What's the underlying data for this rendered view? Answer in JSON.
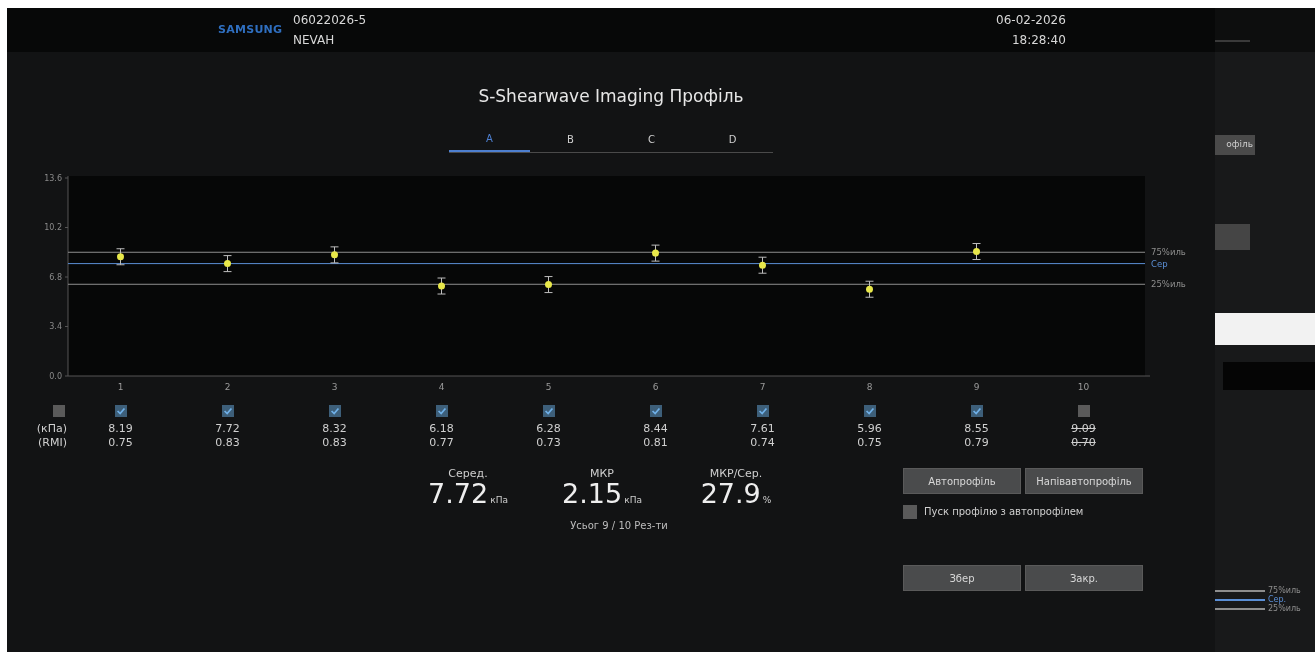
{
  "header": {
    "logo": "SAMSUNG",
    "patient_id": "06022026-5",
    "patient_name": "NEVAH",
    "date": "06-02-2026",
    "time": "18:28:40"
  },
  "title": "S-Shearwave Imaging Профіль",
  "tabs": [
    {
      "label": "A",
      "selected": true
    },
    {
      "label": "B",
      "selected": false
    },
    {
      "label": "C",
      "selected": false
    },
    {
      "label": "D",
      "selected": false
    }
  ],
  "chart_data": {
    "type": "scatter",
    "categories": [
      "1",
      "2",
      "3",
      "4",
      "5",
      "6",
      "7",
      "8",
      "9",
      "10"
    ],
    "series": [
      {
        "color": "#e8e84a",
        "values": [
          8.19,
          7.72,
          8.32,
          6.18,
          6.28,
          8.44,
          7.61,
          5.96,
          8.55,
          null
        ]
      }
    ],
    "ylim": [
      0,
      13.6
    ],
    "yticks": [
      {
        "value": 0,
        "label": "0.0"
      },
      {
        "value": 3.4,
        "label": "3.4"
      },
      {
        "value": 6.8,
        "label": "6.8"
      },
      {
        "value": 10.2,
        "label": "10.2"
      },
      {
        "value": 13.6,
        "label": "13.6"
      }
    ],
    "ref_lines": [
      {
        "axis": "y",
        "value": 8.5,
        "label": "75%иль",
        "color": "#8e8e8e"
      },
      {
        "axis": "y",
        "value": 7.72,
        "label": "Сер",
        "color": "#5b8fd6"
      },
      {
        "axis": "y",
        "value": 6.3,
        "label": "25%иль",
        "color": "#8e8e8e"
      }
    ]
  },
  "measurements": {
    "select_all": {
      "checked": false
    },
    "row_labels": [
      "(кПа)",
      "(RMI)"
    ],
    "columns": [
      {
        "checked": true,
        "kpa": "8.19",
        "rmi": "0.75"
      },
      {
        "checked": true,
        "kpa": "7.72",
        "rmi": "0.83"
      },
      {
        "checked": true,
        "kpa": "8.32",
        "rmi": "0.83"
      },
      {
        "checked": true,
        "kpa": "6.18",
        "rmi": "0.77"
      },
      {
        "checked": true,
        "kpa": "6.28",
        "rmi": "0.73"
      },
      {
        "checked": true,
        "kpa": "8.44",
        "rmi": "0.81"
      },
      {
        "checked": true,
        "kpa": "7.61",
        "rmi": "0.74"
      },
      {
        "checked": true,
        "kpa": "5.96",
        "rmi": "0.75"
      },
      {
        "checked": true,
        "kpa": "8.55",
        "rmi": "0.79"
      },
      {
        "checked": false,
        "kpa": "9.09",
        "rmi": "0.70"
      }
    ]
  },
  "stats": [
    {
      "label": "Серед.",
      "value": "7.72",
      "unit": "кПа"
    },
    {
      "label": "МКР",
      "value": "2.15",
      "unit": "кПа"
    },
    {
      "label": "МКР/Сер.",
      "value": "27.9",
      "unit": "%"
    }
  ],
  "total": "Усьог 9 / 10 Рез-ти",
  "profile_buttons": [
    "Автопрофіль",
    "Напівавтопрофіль"
  ],
  "auto_start": {
    "label": "Пуск профілю з автопрофілем",
    "checked": false
  },
  "actions": [
    "Збер",
    "Закр."
  ],
  "background_window": {
    "button": "офіль",
    "legend": [
      {
        "label": "75%иль",
        "color": "#8e8e8e"
      },
      {
        "label": "Сер.",
        "color": "#5b8fd6"
      },
      {
        "label": "25%иль",
        "color": "#8e8e8e"
      }
    ]
  }
}
